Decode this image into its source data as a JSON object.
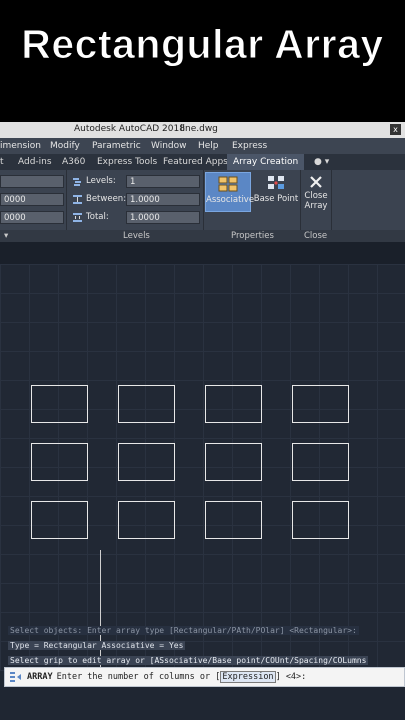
{
  "banner": {
    "title": "Rectangular Array"
  },
  "titlebar": {
    "app": "Autodesk AutoCAD 2018",
    "file": "line.dwg"
  },
  "menubar": {
    "items": [
      "imension",
      "Modify",
      "Parametric",
      "Window",
      "Help",
      "Express"
    ]
  },
  "tabs": {
    "items": [
      "t",
      "Add-ins",
      "A360",
      "Express Tools",
      "Featured Apps"
    ],
    "active": "Array Creation"
  },
  "ribbon": {
    "col_field1": "0000",
    "col_field2": "0000",
    "levels_label": "Levels:",
    "levels_value": "1",
    "between_label": "Between:",
    "between_value": "1.0000",
    "total_label": "Total:",
    "total_value": "1.0000",
    "associative": "Associative",
    "base_point": "Base Point",
    "close_line1": "Close",
    "close_line2": "Array",
    "panel_levels": "Levels",
    "panel_properties": "Properties",
    "panel_close": "Close"
  },
  "array_grid": {
    "rows": 3,
    "columns": 4
  },
  "command": {
    "history1": "Select objects:  Enter array type [Rectangular/PAth/POlar] <Rectangular>:",
    "history2": "Type = Rectangular  Associative = Yes",
    "history3": "Select grip to edit array or [ASsociative/Base point/COUnt/Spacing/COLumns",
    "keyword": "ARRAY",
    "prompt": "Enter the number of columns or",
    "option": "Expression",
    "suffix": "<4>:"
  },
  "colors": {
    "accent": "#5b87c5",
    "canvas": "#212834",
    "grid": "#2a3240"
  }
}
